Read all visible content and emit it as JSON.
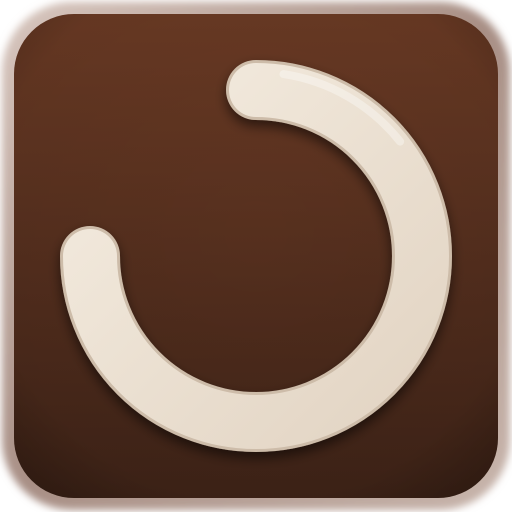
{
  "icon": {
    "name": "progress-ring-icon",
    "progress": 0.75,
    "colors": {
      "background_top": "#6a3a24",
      "background_bottom": "#3e2317",
      "rim": "#b9a39a",
      "ring_light": "#f4ece0",
      "ring_mid": "#e2d4c3",
      "ring_shadow": "#2a140c"
    }
  }
}
